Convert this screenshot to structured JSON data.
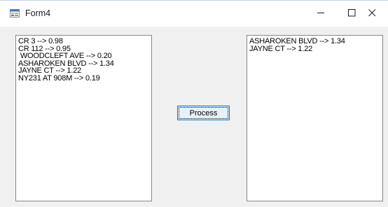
{
  "window": {
    "title": "Form4",
    "controls": {
      "minimize": "minimize-icon",
      "maximize": "maximize-icon",
      "close": "close-icon"
    }
  },
  "left_list": {
    "items": [
      "CR 3 --> 0.98",
      "CR 112 --> 0.95",
      " WOODCLEFT AVE --> 0.20",
      "ASHAROKEN BLVD --> 1.34",
      "JAYNE CT --> 1.22",
      "NY231 AT 908M --> 0.19"
    ]
  },
  "process_button": {
    "label": "Process"
  },
  "right_list": {
    "items": [
      "ASHAROKEN BLVD --> 1.34",
      "JAYNE CT --> 1.22"
    ]
  },
  "colors": {
    "accent": "#0078d7",
    "window_bg": "#f0f0f0",
    "list_border": "#828790"
  }
}
